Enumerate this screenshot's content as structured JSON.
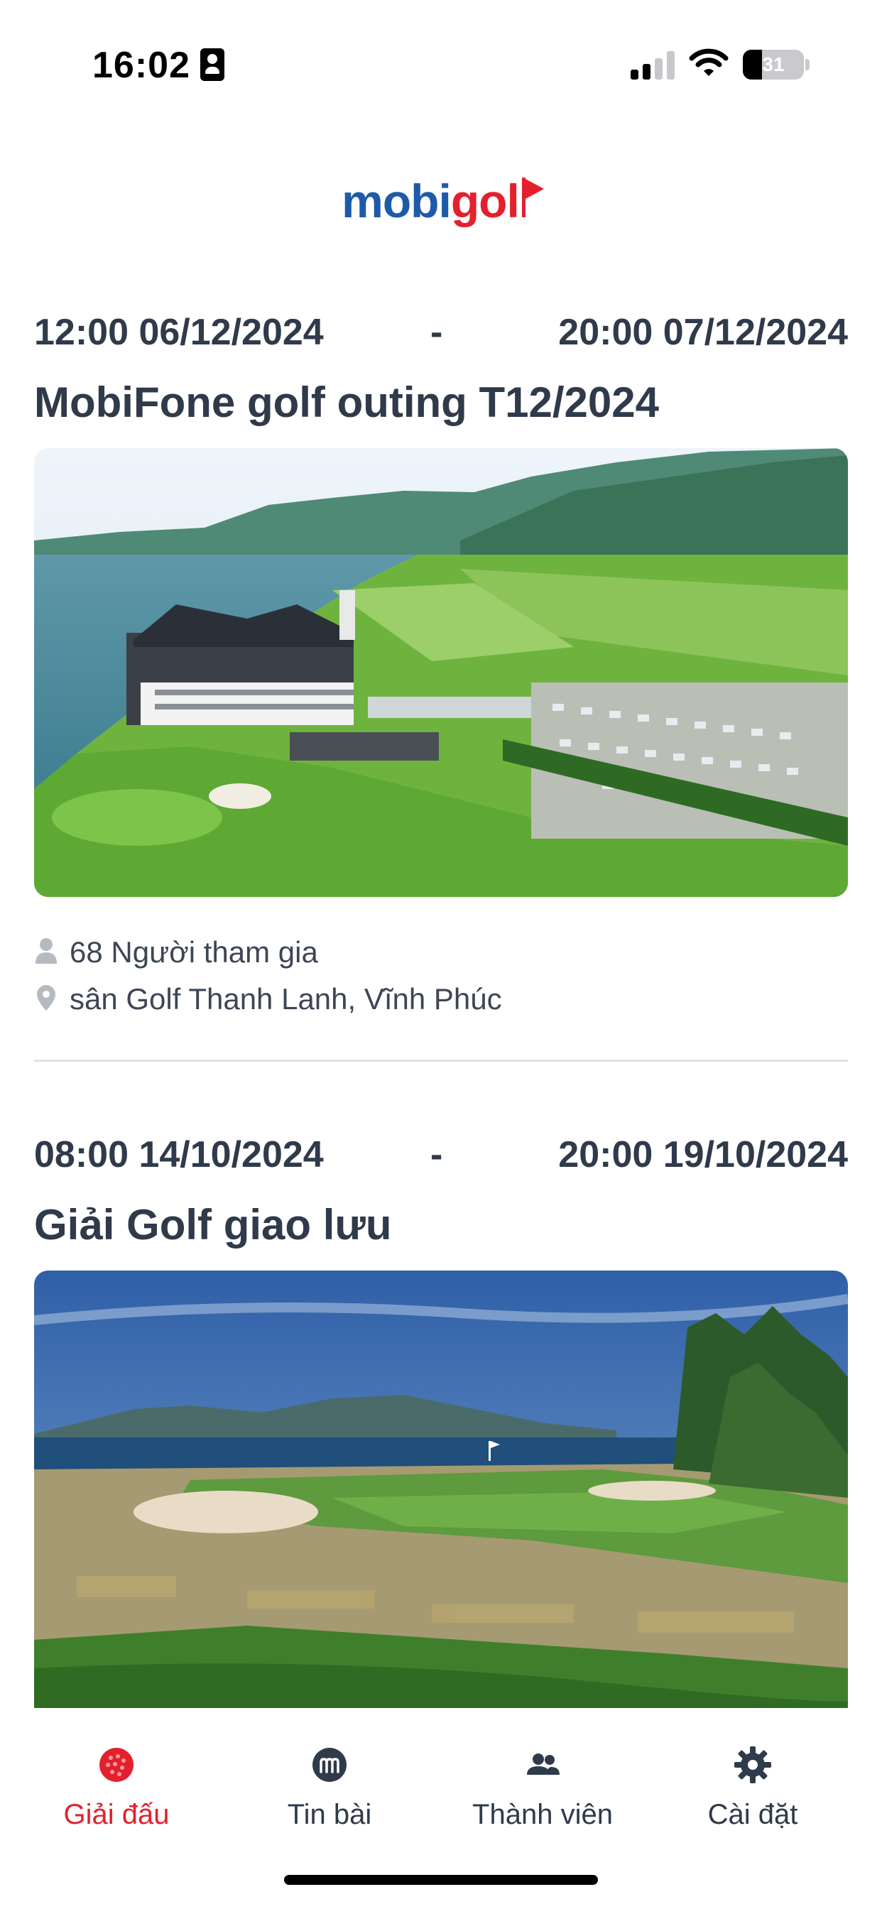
{
  "status_bar": {
    "time": "16:02",
    "battery": "31",
    "battery_level": 0.31,
    "signal_bars_active": 2
  },
  "app": {
    "logo_part_a": "mobi",
    "logo_part_b": "go",
    "logo_part_c": "l",
    "brand_blue": "#1f5aa8",
    "brand_red": "#e4202d"
  },
  "events": [
    {
      "start": "12:00 06/12/2024",
      "separator": "-",
      "end": "20:00 07/12/2024",
      "title": "MobiFone golf outing T12/2024",
      "image_icon": "golf-course-clubhouse-aerial",
      "participants": "68 Người tham gia",
      "location": "sân  Golf Thanh Lanh, Vĩnh Phúc"
    },
    {
      "start": "08:00 14/10/2024",
      "separator": "-",
      "end": "20:00 19/10/2024",
      "title": "Giải Golf giao lưu",
      "image_icon": "seaside-golf-course"
    }
  ],
  "tab_bar": {
    "tabs": [
      {
        "label": "Giải đấu",
        "icon": "golf-ball-icon",
        "active": true
      },
      {
        "label": "Tin bài",
        "icon": "news-m-icon",
        "active": false
      },
      {
        "label": "Thành viên",
        "icon": "members-icon",
        "active": false
      },
      {
        "label": "Cài đặt",
        "icon": "gear-icon",
        "active": false
      }
    ],
    "active_color": "#e4202d",
    "inactive_color": "#2f3a4a"
  }
}
